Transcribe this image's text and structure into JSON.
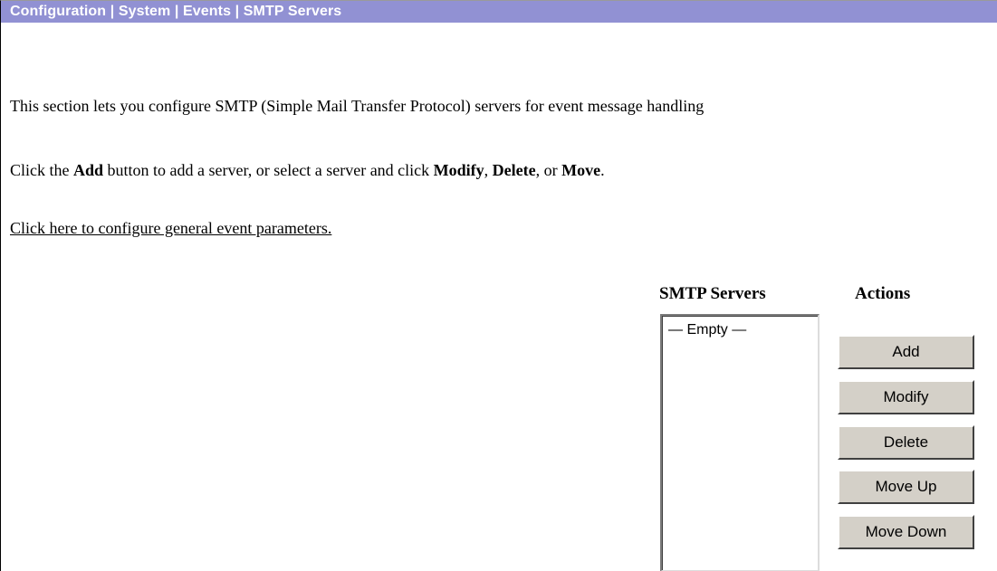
{
  "header": {
    "breadcrumb": "Configuration | System | Events | SMTP Servers"
  },
  "intro": {
    "description": "This section lets you configure SMTP (Simple Mail Transfer Protocol) servers for event message handling",
    "instructions": {
      "part1": "Click the ",
      "add": "Add",
      "part2": " button to add a server, or select a server and click ",
      "modify": "Modify",
      "sep1": ", ",
      "delete": "Delete",
      "sep2": ", or ",
      "move": "Move",
      "end": "."
    },
    "link_text": "Click here to configure general event parameters."
  },
  "servers": {
    "heading": "SMTP Servers",
    "items": [
      "— Empty —"
    ]
  },
  "actions": {
    "heading": "Actions",
    "add_label": "Add",
    "modify_label": "Modify",
    "delete_label": "Delete",
    "move_up_label": "Move Up",
    "move_down_label": "Move Down"
  },
  "colors": {
    "header_bg": "#9191d3",
    "header_text": "#ffffff",
    "button_face": "#d4d0c8"
  }
}
